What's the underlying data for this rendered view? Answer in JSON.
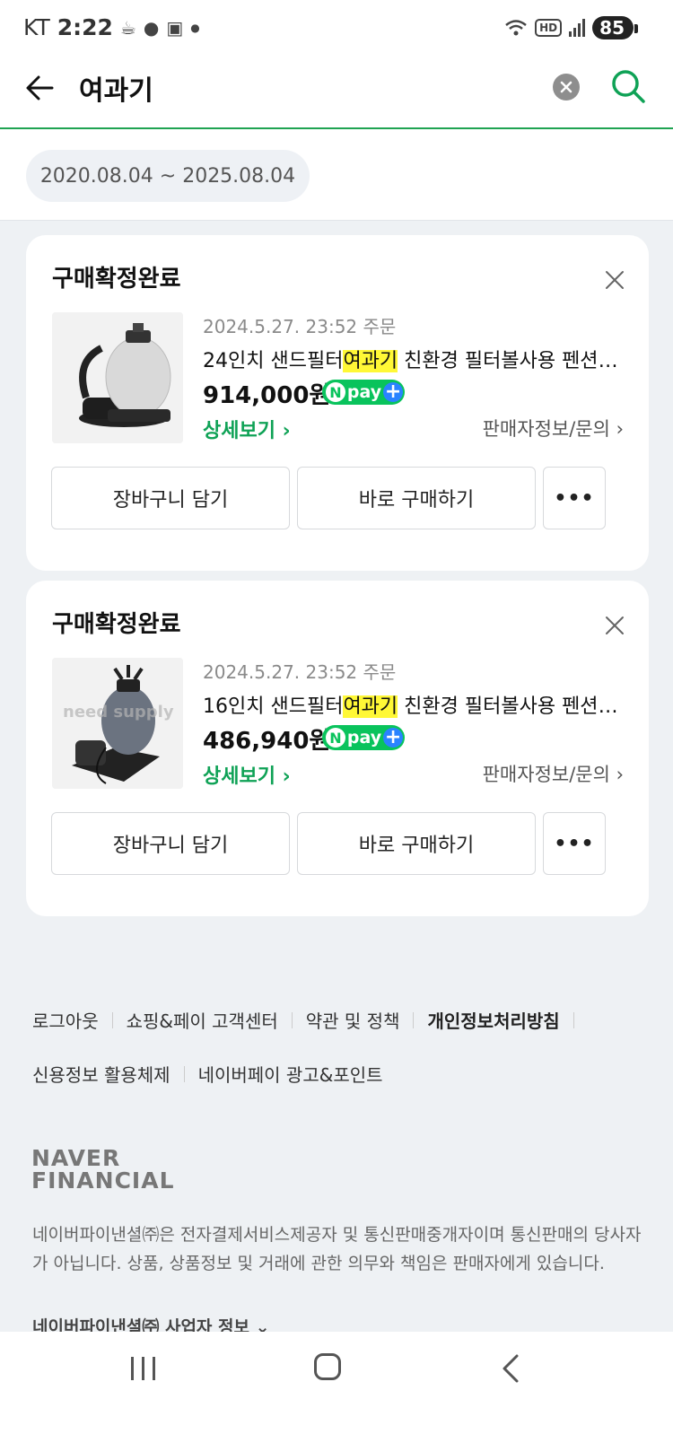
{
  "status_bar": {
    "carrier": "KT",
    "time": "2:22",
    "hd": "HD",
    "battery": "85"
  },
  "header": {
    "query": "여과기"
  },
  "date_range": "2020.08.04 ~ 2025.08.04",
  "orders": [
    {
      "status": "구매확정완료",
      "order_date": "2024.5.27. 23:52 주문",
      "name_before": "24인치 샌드필터",
      "name_highlight": "여과기",
      "name_after": " 친환경 필터볼사용 펜션 수영장",
      "price": "914,000원",
      "detail_label": "상세보기 ›",
      "seller_label": "판매자정보/문의 ›",
      "cart_label": "장바구니 담기",
      "buy_label": "바로 구매하기",
      "more_label": "•••"
    },
    {
      "status": "구매확정완료",
      "order_date": "2024.5.27. 23:52 주문",
      "name_before": "16인치 샌드필터",
      "name_highlight": "여과기",
      "name_after": " 친환경 필터볼사용 펜션 수영장",
      "price": "486,940원",
      "watermark": "need supply",
      "detail_label": "상세보기 ›",
      "seller_label": "판매자정보/문의 ›",
      "cart_label": "장바구니 담기",
      "buy_label": "바로 구매하기",
      "more_label": "•••"
    }
  ],
  "npay": {
    "n": "N",
    "pay": "pay",
    "plus": "+"
  },
  "footer": {
    "links_row1": [
      "로그아웃",
      "쇼핑&페이 고객센터",
      "약관 및 정책",
      "개인정보처리방침"
    ],
    "links_row2": [
      "신용정보 활용체제",
      "네이버페이 광고&포인트"
    ],
    "logo_line1": "NAVER",
    "logo_line2": "FINANCIAL",
    "disclaimer": "네이버파이낸셜㈜은 전자결제서비스제공자 및 통신판매중개자이며 통신판매의 당사자가 아닙니다. 상품, 상품정보 및 거래에 관한 의무와 책임은 판매자에게 있습니다.",
    "biz_info": "네이버파이낸셜㈜ 사업자 정보 ⌄"
  },
  "colors": {
    "accent_green": "#0fa256",
    "npay_green": "#09c35c",
    "highlight": "#fff836"
  }
}
